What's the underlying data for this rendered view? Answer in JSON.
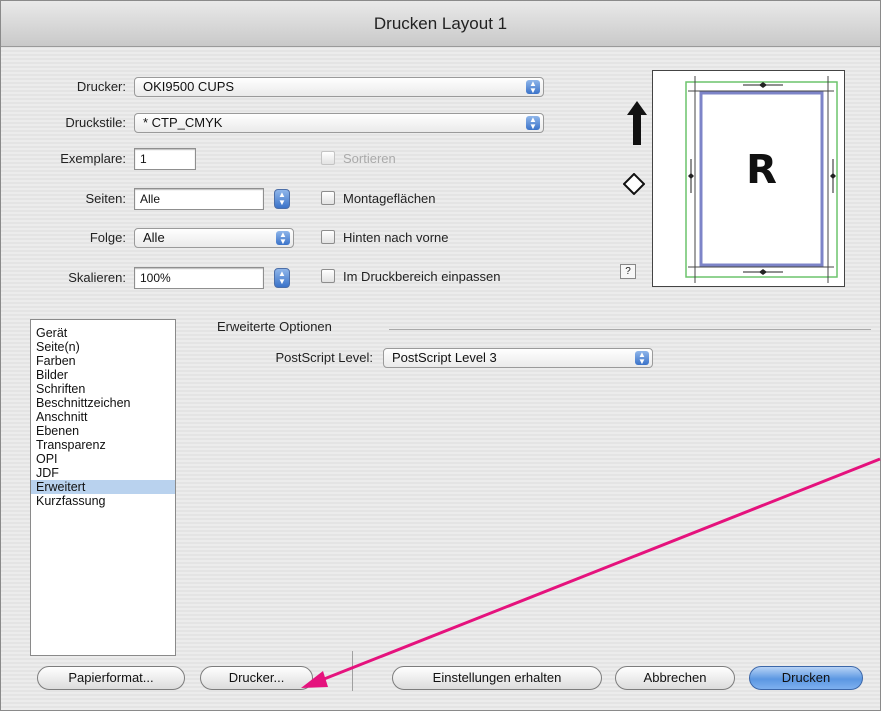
{
  "window": {
    "title": "Drucken Layout 1"
  },
  "fields": {
    "drucker_label": "Drucker:",
    "drucker_value": "OKI9500 CUPS",
    "druckstile_label": "Druckstile:",
    "druckstile_value": "* CTP_CMYK",
    "exemplare_label": "Exemplare:",
    "exemplare_value": "1",
    "seiten_label": "Seiten:",
    "seiten_value": "Alle",
    "folge_label": "Folge:",
    "folge_value": "Alle",
    "skalieren_label": "Skalieren:",
    "skalieren_value": "100%"
  },
  "checkboxes": {
    "sortieren": "Sortieren",
    "montageflaechen": "Montageflächen",
    "hinten_nach_vorne": "Hinten nach vorne",
    "druckbereich": "Im Druckbereich einpassen"
  },
  "preview": {
    "letter": "R",
    "help": "?"
  },
  "category_list": {
    "items": [
      "Gerät",
      "Seite(n)",
      "Farben",
      "Bilder",
      "Schriften",
      "Beschnittzeichen",
      "Anschnitt",
      "Ebenen",
      "Transparenz",
      "OPI",
      "JDF",
      "Erweitert",
      "Kurzfassung"
    ],
    "selected": "Erweitert"
  },
  "advanced": {
    "group_title": "Erweiterte Optionen",
    "postscript_label": "PostScript Level:",
    "postscript_value": "PostScript Level 3"
  },
  "buttons": {
    "papierformat": "Papierformat...",
    "drucker": "Drucker...",
    "einstellungen": "Einstellungen erhalten",
    "abbrechen": "Abbrechen",
    "drucken": "Drucken"
  },
  "colors": {
    "annotation_arrow": "#e5127d",
    "selection": "#b9d2ee",
    "default_button": "#5b97e2"
  }
}
